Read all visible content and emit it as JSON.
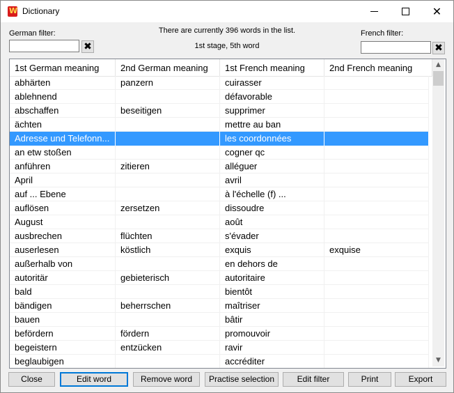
{
  "window": {
    "title": "Dictionary",
    "app_icon_letter": "W",
    "minimize_symbol": "",
    "maximize_symbol": "",
    "close_symbol": "✕"
  },
  "filters": {
    "german_label": "German filter:",
    "french_label": "French filter:",
    "german_value": "",
    "french_value": "",
    "clear_symbol": "✖"
  },
  "status": {
    "word_count_text": "There are currently 396 words in the list.",
    "stage_text": "1st stage, 5th word"
  },
  "table": {
    "headers": [
      "1st German meaning",
      "2nd German meaning",
      "1st French meaning",
      "2nd French meaning"
    ],
    "selected_index": 4,
    "rows": [
      [
        "abhärten",
        "panzern",
        "cuirasser",
        ""
      ],
      [
        "ablehnend",
        "",
        "défavorable",
        ""
      ],
      [
        "abschaffen",
        "beseitigen",
        "supprimer",
        ""
      ],
      [
        "ächten",
        "",
        "mettre au ban",
        ""
      ],
      [
        "Adresse und Telefonn...",
        "",
        "les coordonnées",
        ""
      ],
      [
        "an etw stoßen",
        "",
        "cogner qc",
        ""
      ],
      [
        "anführen",
        "zitieren",
        "alléguer",
        ""
      ],
      [
        "April",
        "",
        "avril",
        ""
      ],
      [
        "auf ... Ebene",
        "",
        "à l'échelle (f) ...",
        ""
      ],
      [
        "auflösen",
        "zersetzen",
        "dissoudre",
        ""
      ],
      [
        "August",
        "",
        "août",
        ""
      ],
      [
        "ausbrechen",
        "flüchten",
        "s'évader",
        ""
      ],
      [
        "auserlesen",
        "köstlich",
        "exquis",
        "exquise"
      ],
      [
        "außerhalb von",
        "",
        "en dehors de",
        ""
      ],
      [
        "autoritär",
        "gebieterisch",
        "autoritaire",
        ""
      ],
      [
        "bald",
        "",
        "bientôt",
        ""
      ],
      [
        "bändigen",
        "beherrschen",
        "maîtriser",
        ""
      ],
      [
        "bauen",
        "",
        "bâtir",
        ""
      ],
      [
        "befördern",
        "fördern",
        "promouvoir",
        ""
      ],
      [
        "begeistern",
        "entzücken",
        "ravir",
        ""
      ],
      [
        "beglaubigen",
        "",
        "accréditer",
        ""
      ]
    ],
    "scroll_up_symbol": "▲",
    "scroll_down_symbol": "▼"
  },
  "buttons": {
    "close": "Close",
    "edit_word": "Edit word",
    "remove_word": "Remove word",
    "practise_selection": "Practise selection",
    "edit_filter": "Edit filter",
    "print": "Print",
    "export": "Export"
  },
  "colors": {
    "selection": "#3399ff",
    "default_button_border": "#0078d7"
  }
}
